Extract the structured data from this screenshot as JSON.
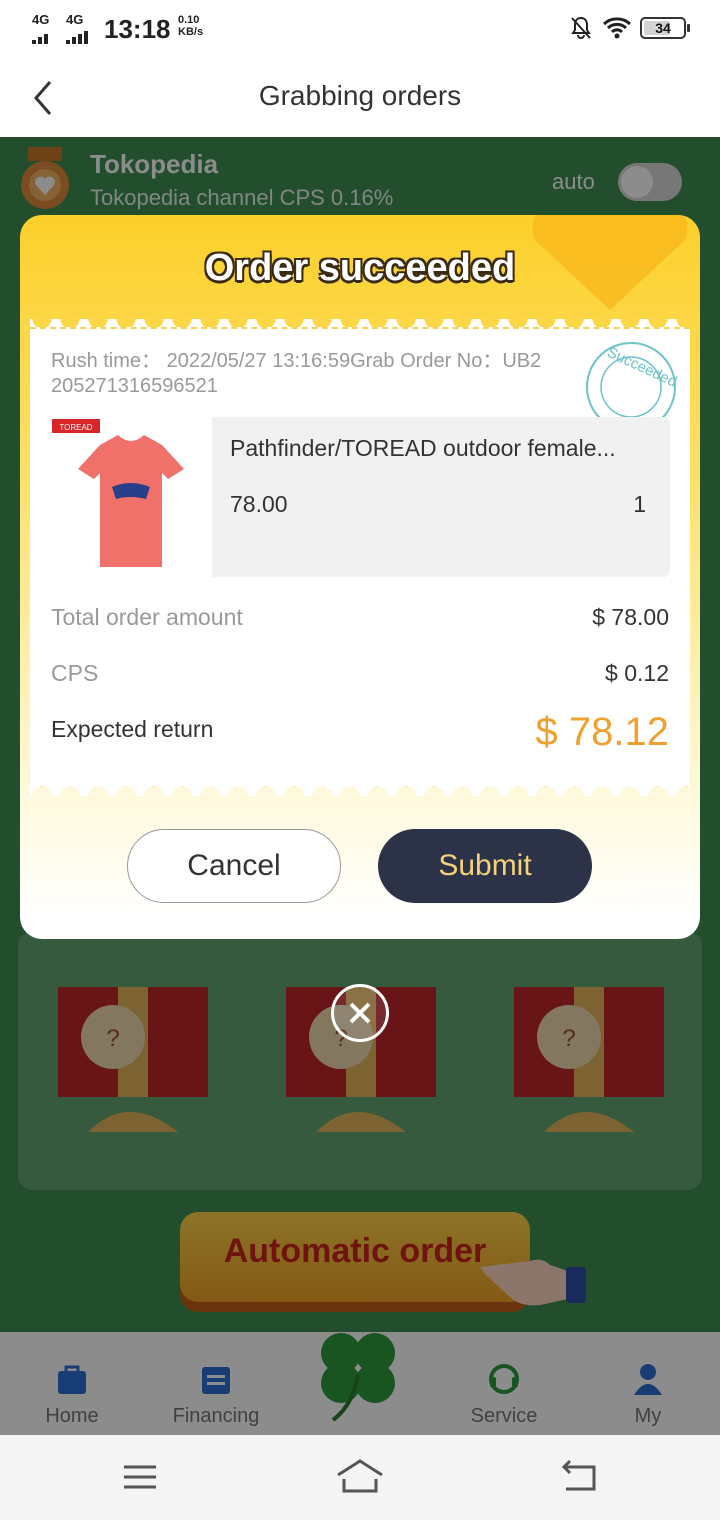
{
  "status_bar": {
    "network_1": "4G",
    "network_2": "4G",
    "time": "13:18",
    "speed_value": "0.10",
    "speed_unit": "KB/s",
    "battery": "34"
  },
  "nav": {
    "title": "Grabbing orders"
  },
  "channel": {
    "name": "Tokopedia",
    "subtitle": "Tokopedia channel CPS 0.16%",
    "auto_label": "auto",
    "auto_enabled": false
  },
  "modal": {
    "title": "Order succeeded",
    "rush_line": "Rush time：  2022/05/27 13:16:59Grab Order No：UB2205271316596521",
    "stamp_text": "Succeeded",
    "product": {
      "brand_tag": "TOREAD",
      "name": "Pathfinder/TOREAD outdoor female...",
      "price": "78.00",
      "qty": "1"
    },
    "total_label": "Total order amount",
    "total_value": "$ 78.00",
    "cps_label": "CPS",
    "cps_value": "$ 0.12",
    "expected_label": "Expected return",
    "expected_value": "$ 78.12",
    "cancel": "Cancel",
    "submit": "Submit"
  },
  "gifts": [
    "?",
    "?",
    "?"
  ],
  "auto_order": "Automatic order",
  "tabs": [
    "Home",
    "Financing",
    "Service",
    "My"
  ],
  "colors": {
    "green_bg": "#3f8f55",
    "submit_bg": "#2c3348",
    "accent_orange": "#f0a030",
    "modal_yellow": "#fcd02a"
  }
}
